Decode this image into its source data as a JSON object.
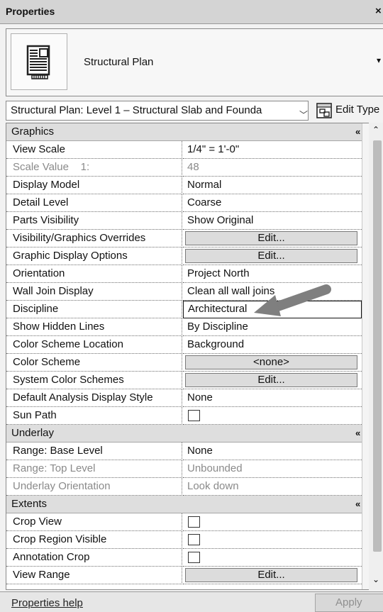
{
  "window": {
    "title": "Properties",
    "close_glyph": "×"
  },
  "type_selector": {
    "name": "Structural Plan",
    "icon": "floor-plan-icon",
    "dropdown_glyph": "▾"
  },
  "instance_selector": {
    "value": "Structural Plan: Level 1 – Structural Slab and Founda",
    "chevron": "﹀",
    "edit_type_label": "Edit Type",
    "edit_type_icon": "edit-type-icon"
  },
  "groups": {
    "graphics": {
      "title": "Graphics",
      "collapse_glyph": "«",
      "rows": {
        "view_scale": {
          "label": "View Scale",
          "value": "1/4\" = 1'-0\""
        },
        "scale_value": {
          "label": "Scale Value    1:",
          "value": "48"
        },
        "display_model": {
          "label": "Display Model",
          "value": "Normal"
        },
        "detail_level": {
          "label": "Detail Level",
          "value": "Coarse"
        },
        "parts_visibility": {
          "label": "Parts Visibility",
          "value": "Show Original"
        },
        "vg_overrides": {
          "label": "Visibility/Graphics Overrides",
          "value": "Edit..."
        },
        "graphic_display": {
          "label": "Graphic Display Options",
          "value": "Edit..."
        },
        "orientation": {
          "label": "Orientation",
          "value": "Project North"
        },
        "wall_join": {
          "label": "Wall Join Display",
          "value": "Clean all wall joins"
        },
        "discipline": {
          "label": "Discipline",
          "value": "Architectural"
        },
        "hidden_lines": {
          "label": "Show Hidden Lines",
          "value": "By Discipline"
        },
        "cs_location": {
          "label": "Color Scheme Location",
          "value": "Background"
        },
        "color_scheme": {
          "label": "Color Scheme",
          "value": "<none>"
        },
        "system_color": {
          "label": "System Color Schemes",
          "value": "Edit..."
        },
        "analysis_style": {
          "label": "Default Analysis Display Style",
          "value": "None"
        },
        "sun_path": {
          "label": "Sun Path",
          "checked": false
        }
      }
    },
    "underlay": {
      "title": "Underlay",
      "collapse_glyph": "«",
      "rows": {
        "base_level": {
          "label": "Range: Base Level",
          "value": "None"
        },
        "top_level": {
          "label": "Range: Top Level",
          "value": "Unbounded"
        },
        "orientation": {
          "label": "Underlay Orientation",
          "value": "Look down"
        }
      }
    },
    "extents": {
      "title": "Extents",
      "collapse_glyph": "«",
      "rows": {
        "crop_view": {
          "label": "Crop View",
          "checked": false
        },
        "crop_region": {
          "label": "Crop Region Visible",
          "checked": false
        },
        "annotation_crop": {
          "label": "Annotation Crop",
          "checked": false
        },
        "view_range": {
          "label": "View Range",
          "value": "Edit..."
        }
      }
    }
  },
  "scrollbar": {
    "up_glyph": "⌃",
    "down_glyph": "⌄"
  },
  "footer": {
    "help_label": "Properties help",
    "apply_label": "Apply"
  },
  "annotation": {
    "arrow": "annotation-arrow"
  },
  "colors": {
    "grid_bg": "#ffffff",
    "header_bg": "#dedede",
    "button_bg": "#dcdcdc",
    "arrow": "#7f7f7f"
  }
}
